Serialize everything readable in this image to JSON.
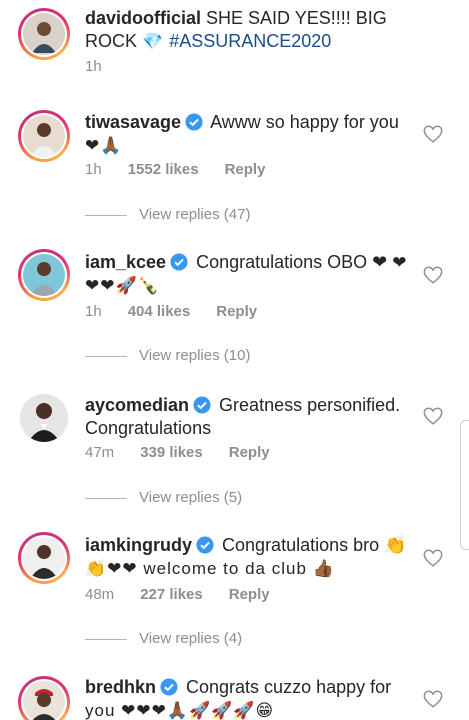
{
  "post": {
    "username": "davidoofficial",
    "caption": " SHE SAID YES!!!! BIG ROCK",
    "emoji": "💎",
    "hashtag": " #ASSURANCE2020",
    "time": "1h"
  },
  "comments": [
    {
      "username": "tiwasavage",
      "text": " Awww so happy for you",
      "emoji": "❤🙏🏾",
      "time": "1h",
      "likes": "1552 likes",
      "reply": "Reply",
      "view_replies": "View replies (47)"
    },
    {
      "username": "iam_kcee",
      "text": " Congratulations OBO ❤",
      "emoji": "❤❤❤🚀🍾",
      "time": "1h",
      "likes": "404 likes",
      "reply": "Reply",
      "view_replies": "View replies (10)"
    },
    {
      "username": "aycomedian",
      "text": " Greatness personified. Congratulations",
      "emoji": "",
      "time": "47m",
      "likes": "339 likes",
      "reply": "Reply",
      "view_replies": "View replies (5)"
    },
    {
      "username": "iamkingrudy",
      "text": " Congratulations bro 👏",
      "emoji": "👏❤❤ welcome to da club 👍🏾",
      "time": "48m",
      "likes": "227 likes",
      "reply": "Reply",
      "view_replies": "View replies (4)"
    },
    {
      "username": "bredhkn",
      "text": " Congrats cuzzo happy for",
      "emoji": "you ❤❤❤🙏🏾🚀🚀🚀😁",
      "time": "",
      "likes": "",
      "reply": "",
      "view_replies": ""
    }
  ],
  "colors": {
    "verified": "#3897f0",
    "hashtag": "#1b4c8a",
    "meta": "#8e8e8e"
  }
}
